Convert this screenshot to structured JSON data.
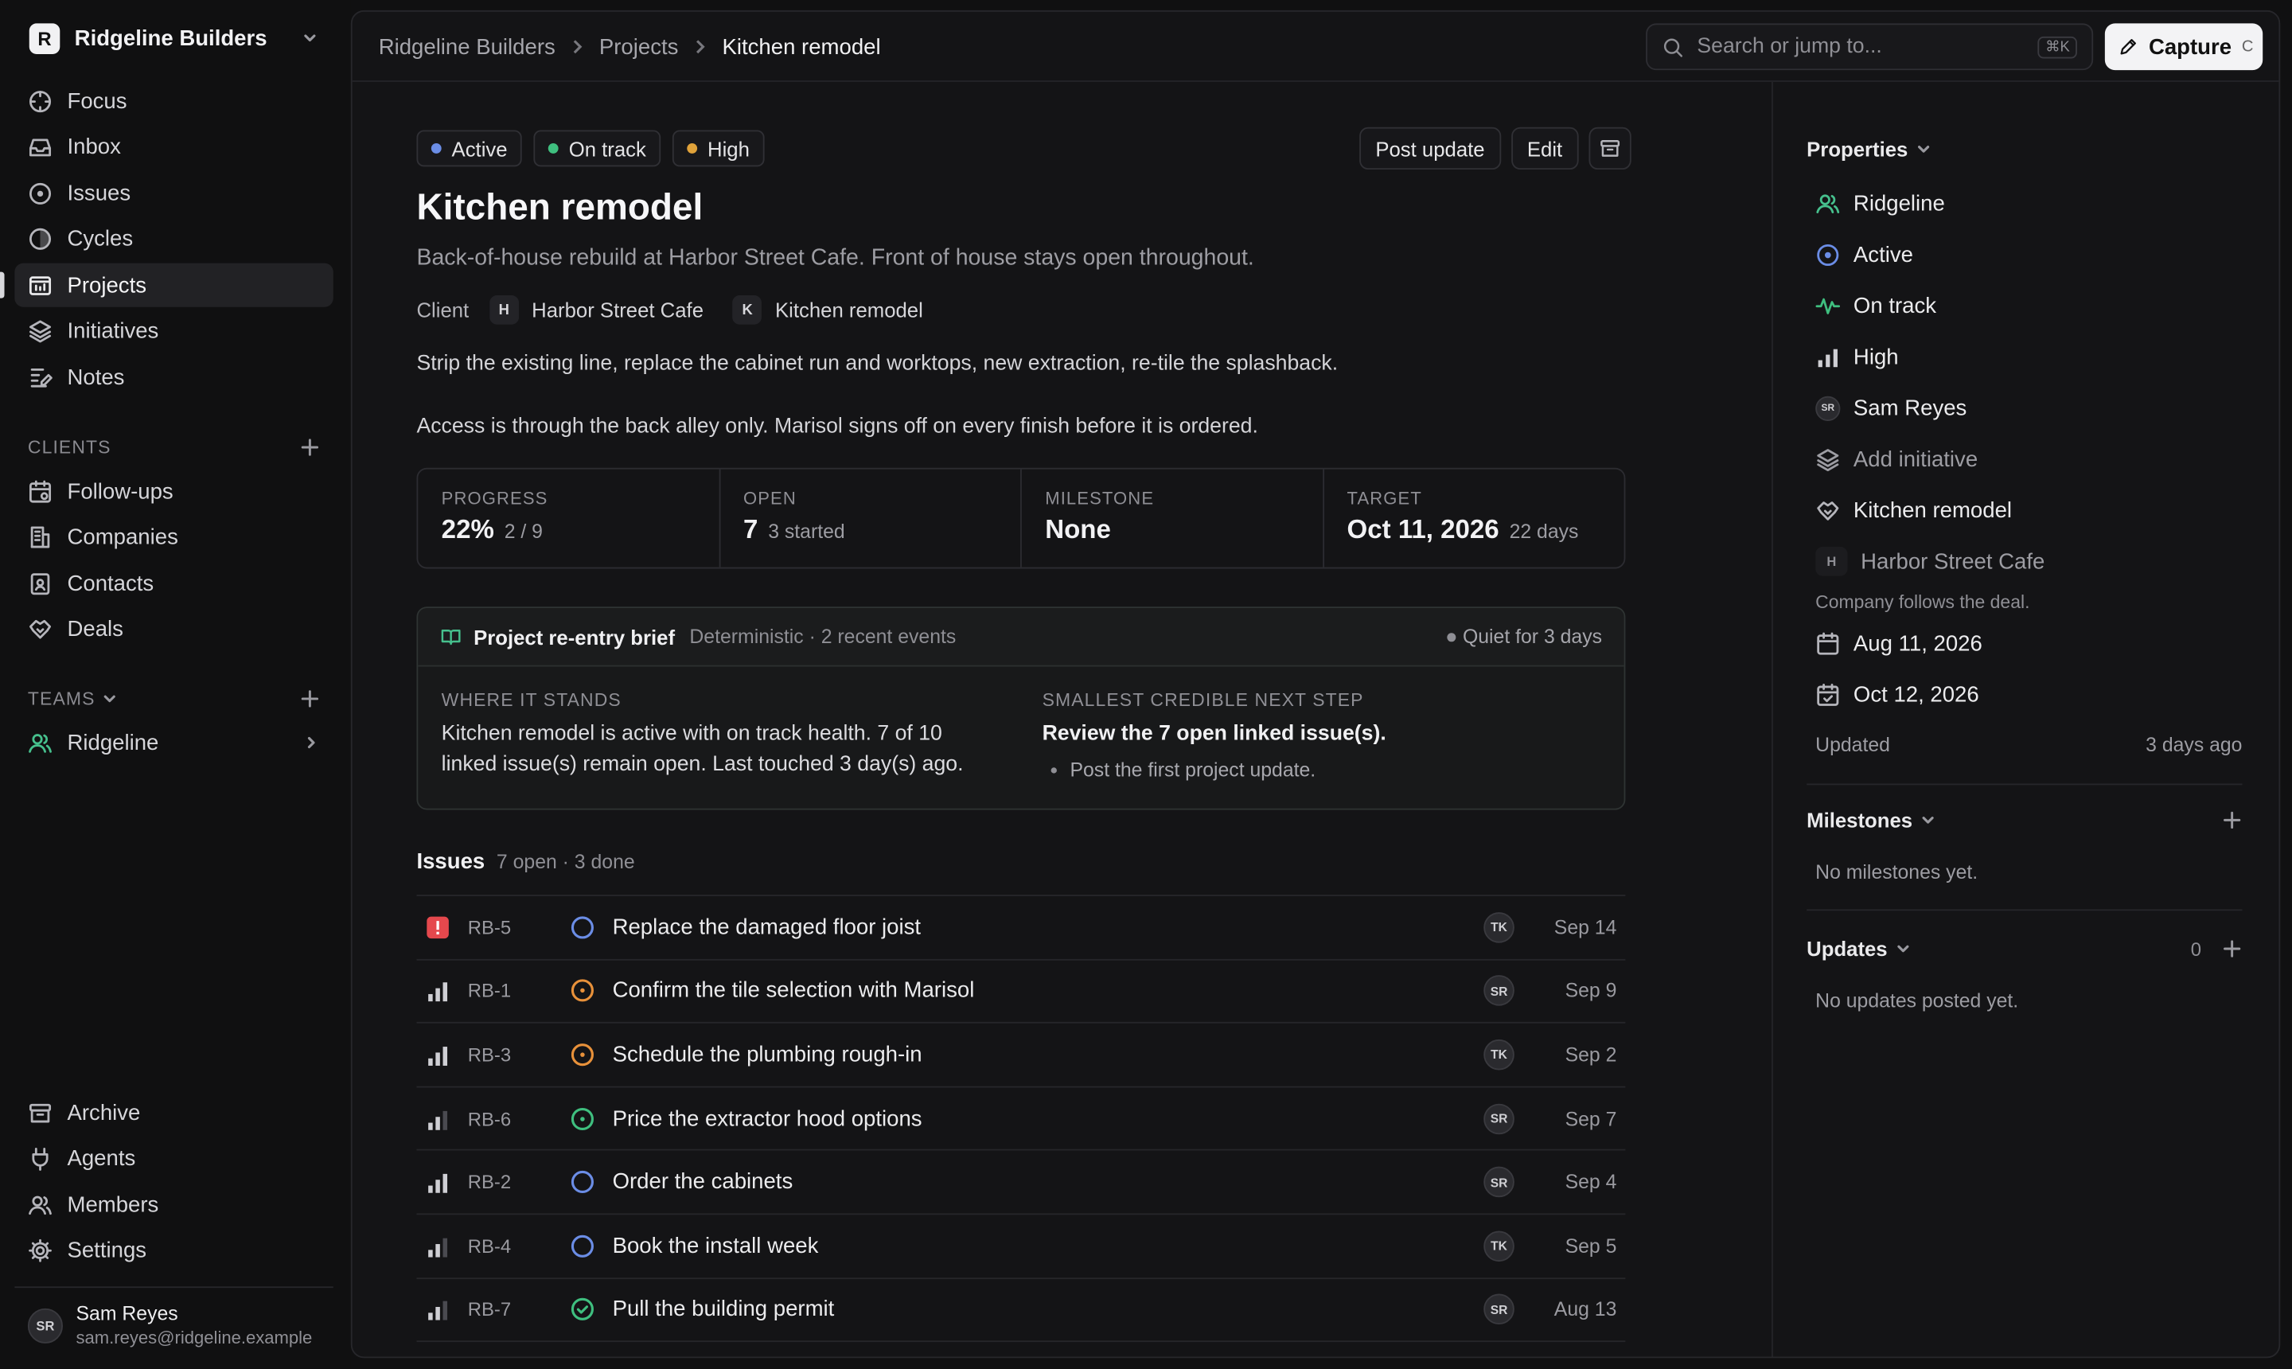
{
  "workspace": {
    "name": "Ridgeline Builders",
    "initial": "R"
  },
  "nav": [
    {
      "label": "Focus",
      "icon": "focus-icon"
    },
    {
      "label": "Inbox",
      "icon": "inbox-icon"
    },
    {
      "label": "Issues",
      "icon": "issues-icon"
    },
    {
      "label": "Cycles",
      "icon": "cycles-icon"
    },
    {
      "label": "Projects",
      "icon": "projects-icon",
      "active": true
    },
    {
      "label": "Initiatives",
      "icon": "initiatives-icon"
    },
    {
      "label": "Notes",
      "icon": "notes-icon"
    }
  ],
  "clients_section": {
    "label": "CLIENTS",
    "items": [
      {
        "label": "Follow-ups",
        "icon": "follow-ups-icon"
      },
      {
        "label": "Companies",
        "icon": "companies-icon"
      },
      {
        "label": "Contacts",
        "icon": "contacts-icon"
      },
      {
        "label": "Deals",
        "icon": "deals-icon"
      }
    ]
  },
  "teams_section": {
    "label": "TEAMS",
    "items": [
      {
        "label": "Ridgeline",
        "icon": "team-icon"
      }
    ]
  },
  "bottom_nav": [
    {
      "label": "Archive",
      "icon": "archive-icon"
    },
    {
      "label": "Agents",
      "icon": "agents-icon"
    },
    {
      "label": "Members",
      "icon": "members-icon"
    },
    {
      "label": "Settings",
      "icon": "settings-icon"
    }
  ],
  "user": {
    "initials": "SR",
    "name": "Sam Reyes",
    "email": "sam.reyes@ridgeline.example"
  },
  "breadcrumb": [
    "Ridgeline Builders",
    "Projects",
    "Kitchen remodel"
  ],
  "search": {
    "placeholder": "Search or jump to...",
    "shortcut": "⌘K"
  },
  "capture": {
    "label": "Capture",
    "shortcut": "C"
  },
  "project": {
    "badges": [
      {
        "label": "Active",
        "color": "#6b8de6"
      },
      {
        "label": "On track",
        "color": "#3fbf7f"
      },
      {
        "label": "High",
        "color": "#e0a23a"
      }
    ],
    "actions": {
      "post_update": "Post update",
      "edit": "Edit"
    },
    "title": "Kitchen remodel",
    "description": "Back-of-house rebuild at Harbor Street Cafe. Front of house stays open throughout.",
    "client_label": "Client",
    "client": {
      "initial": "H",
      "name": "Harbor Street Cafe"
    },
    "deal": {
      "initial": "K",
      "name": "Kitchen remodel"
    },
    "body": [
      "Strip the existing line, replace the cabinet run and worktops, new extraction, re-tile the splashback.",
      "Access is through the back alley only. Marisol signs off on every finish before it is ordered."
    ],
    "stats": [
      {
        "key": "PROGRESS",
        "value": "22%",
        "sub": "2 / 9"
      },
      {
        "key": "OPEN",
        "value": "7",
        "sub": "3 started"
      },
      {
        "key": "MILESTONE",
        "value": "None",
        "sub": ""
      },
      {
        "key": "TARGET",
        "value": "Oct 11, 2026",
        "sub": "22 days"
      }
    ],
    "brief": {
      "title": "Project re-entry brief",
      "meta": "Deterministic · 2 recent events",
      "quiet": "Quiet for 3 days",
      "where_label": "WHERE IT STANDS",
      "where_text": "Kitchen remodel is active with on track health. 7 of 10 linked issue(s) remain open. Last touched 3 day(s) ago.",
      "next_label": "SMALLEST CREDIBLE NEXT STEP",
      "next_text": "Review the 7 open linked issue(s).",
      "next_bullet": "Post the first project update."
    },
    "issues_title": "Issues",
    "issues_meta": "7 open · 3 done",
    "issues": [
      {
        "id": "RB-5",
        "title": "Replace the damaged floor joist",
        "priority": "urgent",
        "status": "todo",
        "assignee": "TK",
        "date": "Sep 14"
      },
      {
        "id": "RB-1",
        "title": "Confirm the tile selection with Marisol",
        "priority": "high",
        "status": "in-progress",
        "assignee": "SR",
        "date": "Sep 9"
      },
      {
        "id": "RB-3",
        "title": "Schedule the plumbing rough-in",
        "priority": "high",
        "status": "in-progress",
        "assignee": "TK",
        "date": "Sep 2"
      },
      {
        "id": "RB-6",
        "title": "Price the extractor hood options",
        "priority": "medium",
        "status": "in-review",
        "assignee": "SR",
        "date": "Sep 7"
      },
      {
        "id": "RB-2",
        "title": "Order the cabinets",
        "priority": "high",
        "status": "todo",
        "assignee": "SR",
        "date": "Sep 4"
      },
      {
        "id": "RB-4",
        "title": "Book the install week",
        "priority": "medium",
        "status": "todo",
        "assignee": "TK",
        "date": "Sep 5"
      },
      {
        "id": "RB-7",
        "title": "Pull the building permit",
        "priority": "medium",
        "status": "done",
        "assignee": "SR",
        "date": "Aug 13"
      }
    ]
  },
  "properties": {
    "title": "Properties",
    "items": [
      {
        "label": "Ridgeline",
        "icon": "team-icon",
        "color": "#46c08d"
      },
      {
        "label": "Active",
        "icon": "status-active-icon",
        "color": "#6b8de6"
      },
      {
        "label": "On track",
        "icon": "health-icon",
        "color": "#3fbf7f"
      },
      {
        "label": "High",
        "icon": "priority-high-icon",
        "color": "#cfcfd4"
      },
      {
        "label": "Sam Reyes",
        "icon": "avatar",
        "initials": "SR"
      },
      {
        "label": "Add initiative",
        "icon": "initiatives-icon",
        "muted": true
      },
      {
        "label": "Kitchen remodel",
        "icon": "deal-icon"
      },
      {
        "label": "Harbor Street Cafe",
        "icon": "company-chip",
        "initial": "H",
        "muted": true
      }
    ],
    "company_note": "Company follows the deal.",
    "start_date": "Aug 11, 2026",
    "target_date": "Oct 12, 2026",
    "updated_label": "Updated",
    "updated_value": "3 days ago"
  },
  "milestones": {
    "title": "Milestones",
    "empty": "No milestones yet."
  },
  "updates": {
    "title": "Updates",
    "count": "0",
    "empty": "No updates posted yet."
  }
}
